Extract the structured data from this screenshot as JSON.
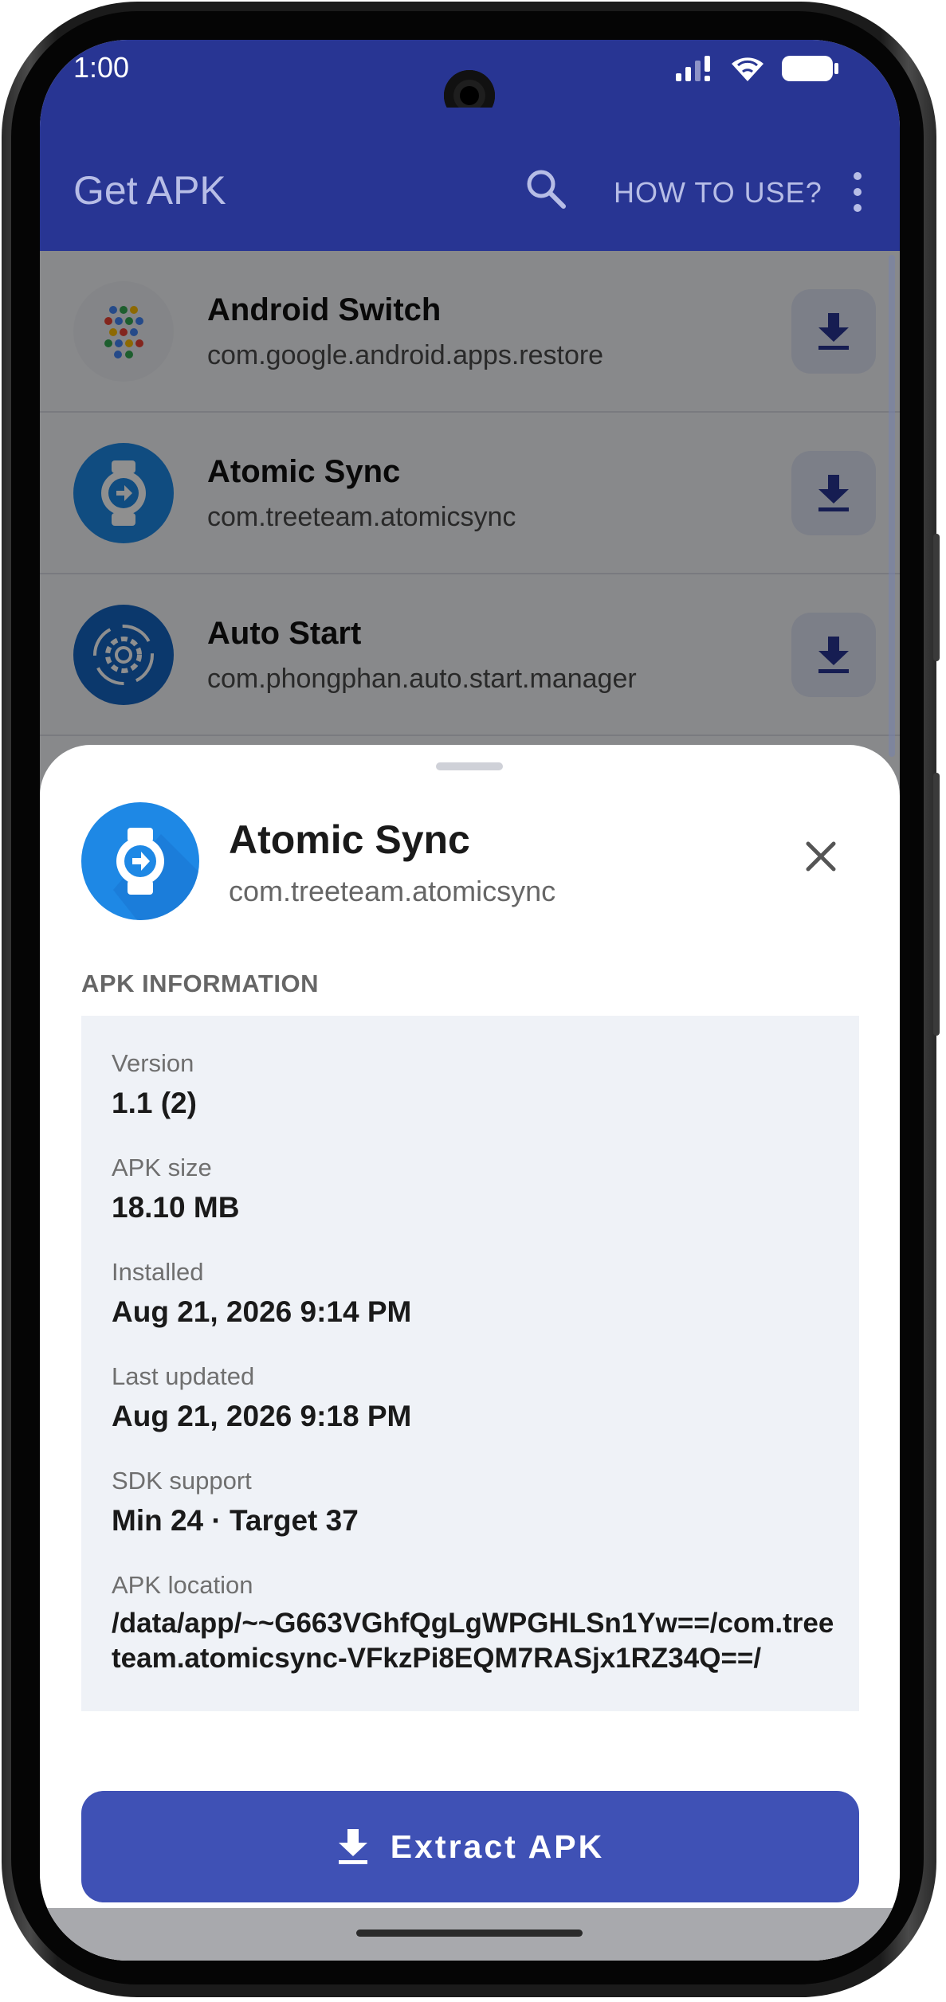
{
  "status_bar": {
    "time": "1:00"
  },
  "app_bar": {
    "title": "Get APK",
    "search_icon": "search-icon",
    "how_to_use": "HOW TO USE?",
    "more_icon": "more-vert-icon"
  },
  "app_list": {
    "items": [
      {
        "name": "Android Switch",
        "package": "com.google.android.apps.restore",
        "icon": "android-switch-icon"
      },
      {
        "name": "Atomic Sync",
        "package": "com.treeteam.atomicsync",
        "icon": "watch-sync-icon"
      },
      {
        "name": "Auto Start",
        "package": "com.phongphan.auto.start.manager",
        "icon": "gear-cycle-icon"
      }
    ],
    "download_icon": "download-icon"
  },
  "sheet": {
    "app_name": "Atomic Sync",
    "package": "com.treeteam.atomicsync",
    "close_icon": "close-icon",
    "section_title": "APK INFORMATION",
    "info": [
      {
        "label": "Version",
        "value": "1.1 (2)"
      },
      {
        "label": "APK size",
        "value": "18.10 MB"
      },
      {
        "label": "Installed",
        "value": "Aug 21, 2026 9:14 PM"
      },
      {
        "label": "Last updated",
        "value": "Aug 21, 2026 9:18 PM"
      },
      {
        "label": "SDK support",
        "value": "Min 24 · Target 37"
      },
      {
        "label": "APK location",
        "value": "/data/app/~~G663VGhfQgLgWPGHLSn1Yw==/com.treeteam.atomicsync-VFkzPi8EQM7RASjx1RZ34Q==/"
      }
    ],
    "extract_button": "Extract APK"
  },
  "colors": {
    "app_bar": "#283593",
    "accent": "#3f51b5",
    "card_bg": "#eff2f7",
    "icon_blue": "#1e88e5"
  }
}
